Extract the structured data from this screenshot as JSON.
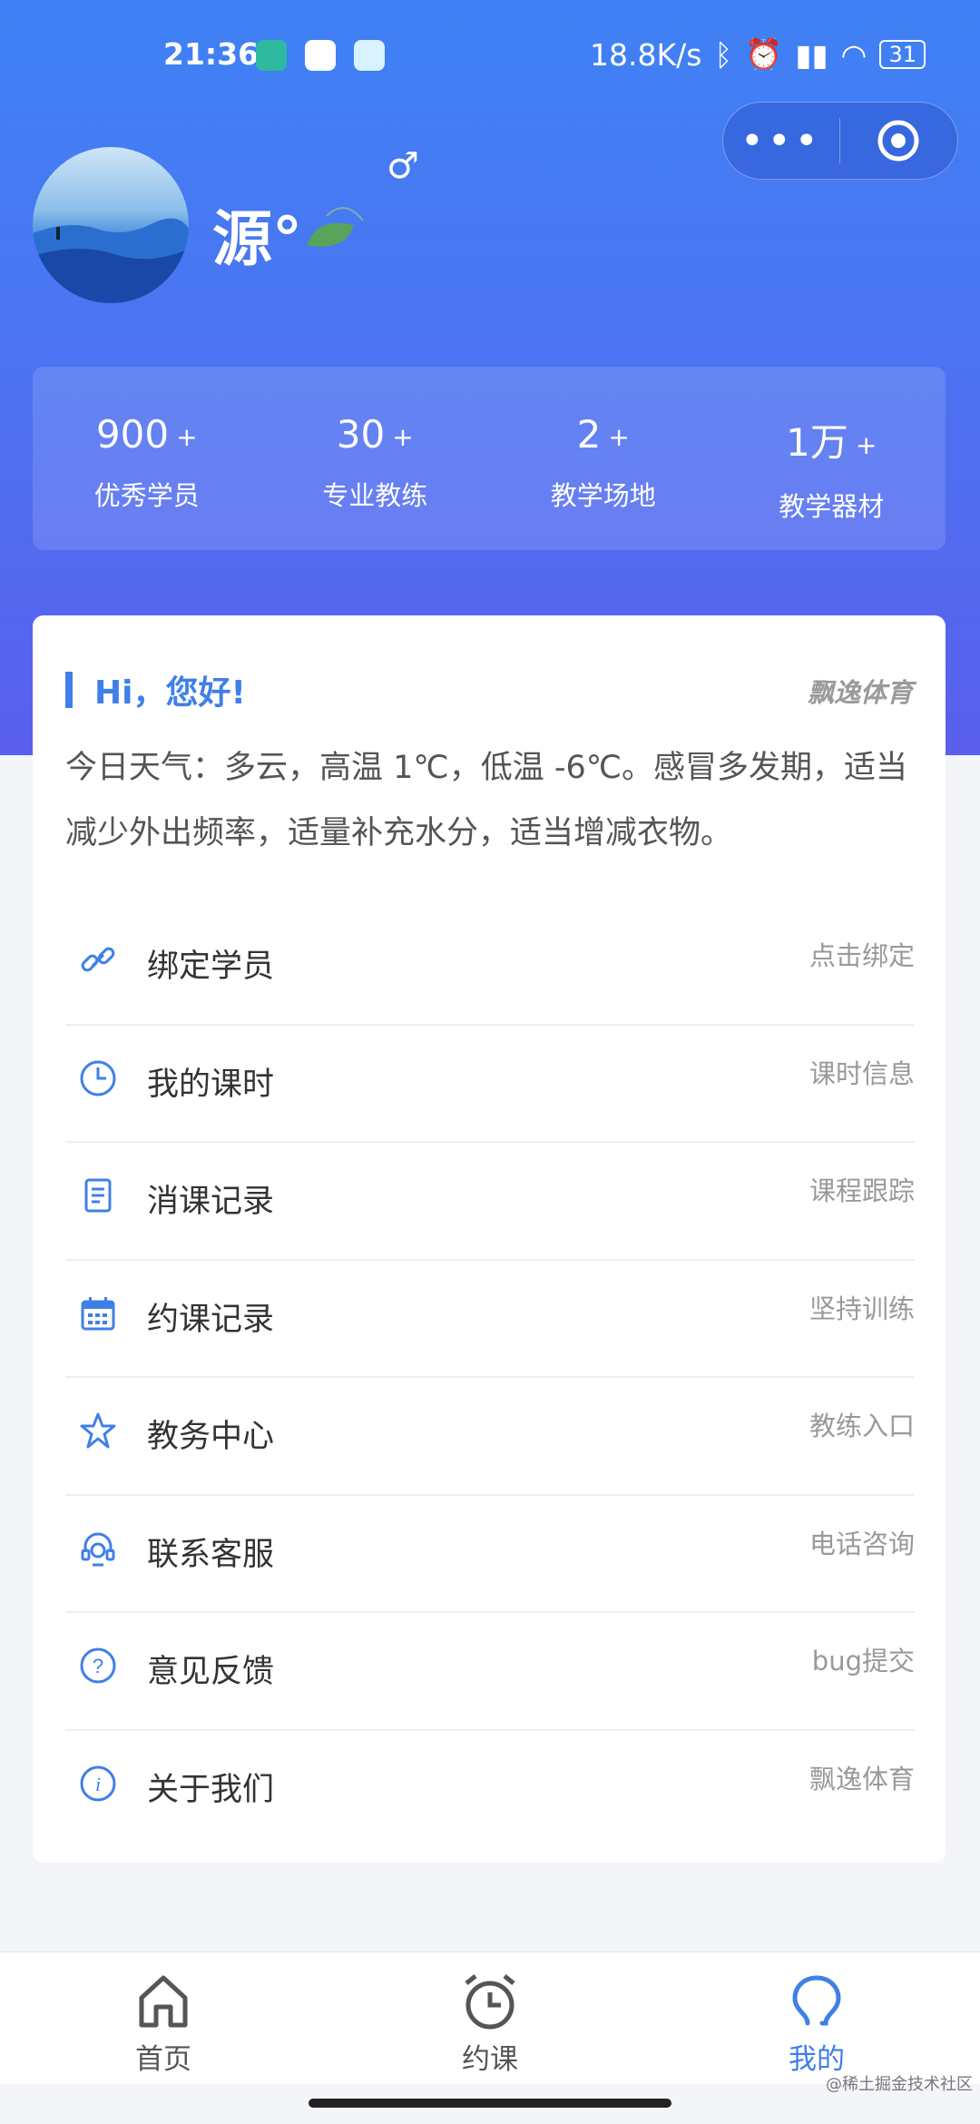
{
  "status_bar": {
    "time": "21:36",
    "net_speed": "18.8K/s",
    "battery": "31"
  },
  "user": {
    "name": "源°",
    "gender_symbol": "♂"
  },
  "stats": [
    {
      "value": "900",
      "suffix": "+",
      "label": "优秀学员"
    },
    {
      "value": "30",
      "suffix": "+",
      "label": "专业教练"
    },
    {
      "value": "2",
      "suffix": "+",
      "label": "教学场地"
    },
    {
      "value": "1万",
      "suffix": "+",
      "label": "教学器材"
    }
  ],
  "card": {
    "greeting": "Hi，您好!",
    "brand": "飘逸体育",
    "weather": "今日天气：多云，高温 1℃，低温 -6℃。感冒多发期，适当减少外出频率，适量补充水分，适当增减衣物。"
  },
  "menu": [
    {
      "icon": "link-icon",
      "label": "绑定学员",
      "action": "点击绑定"
    },
    {
      "icon": "clock-icon",
      "label": "我的课时",
      "action": "课时信息"
    },
    {
      "icon": "document-icon",
      "label": "消课记录",
      "action": "课程跟踪"
    },
    {
      "icon": "calendar-icon",
      "label": "约课记录",
      "action": "坚持训练"
    },
    {
      "icon": "star-icon",
      "label": "教务中心",
      "action": "教练入口"
    },
    {
      "icon": "headset-icon",
      "label": "联系客服",
      "action": "电话咨询"
    },
    {
      "icon": "question-icon",
      "label": "意见反馈",
      "action": "bug提交"
    },
    {
      "icon": "info-icon",
      "label": "关于我们",
      "action": "飘逸体育"
    }
  ],
  "tabs": [
    {
      "icon": "home-icon",
      "label": "首页",
      "active": false
    },
    {
      "icon": "alarm-clock-icon",
      "label": "约课",
      "active": false
    },
    {
      "icon": "profile-icon",
      "label": "我的",
      "active": true
    }
  ],
  "watermark": "@稀土掘金技术社区",
  "colors": {
    "accent": "#3f7fe8",
    "hero_top": "#3f82f5",
    "hero_bottom": "#5a5fec"
  }
}
